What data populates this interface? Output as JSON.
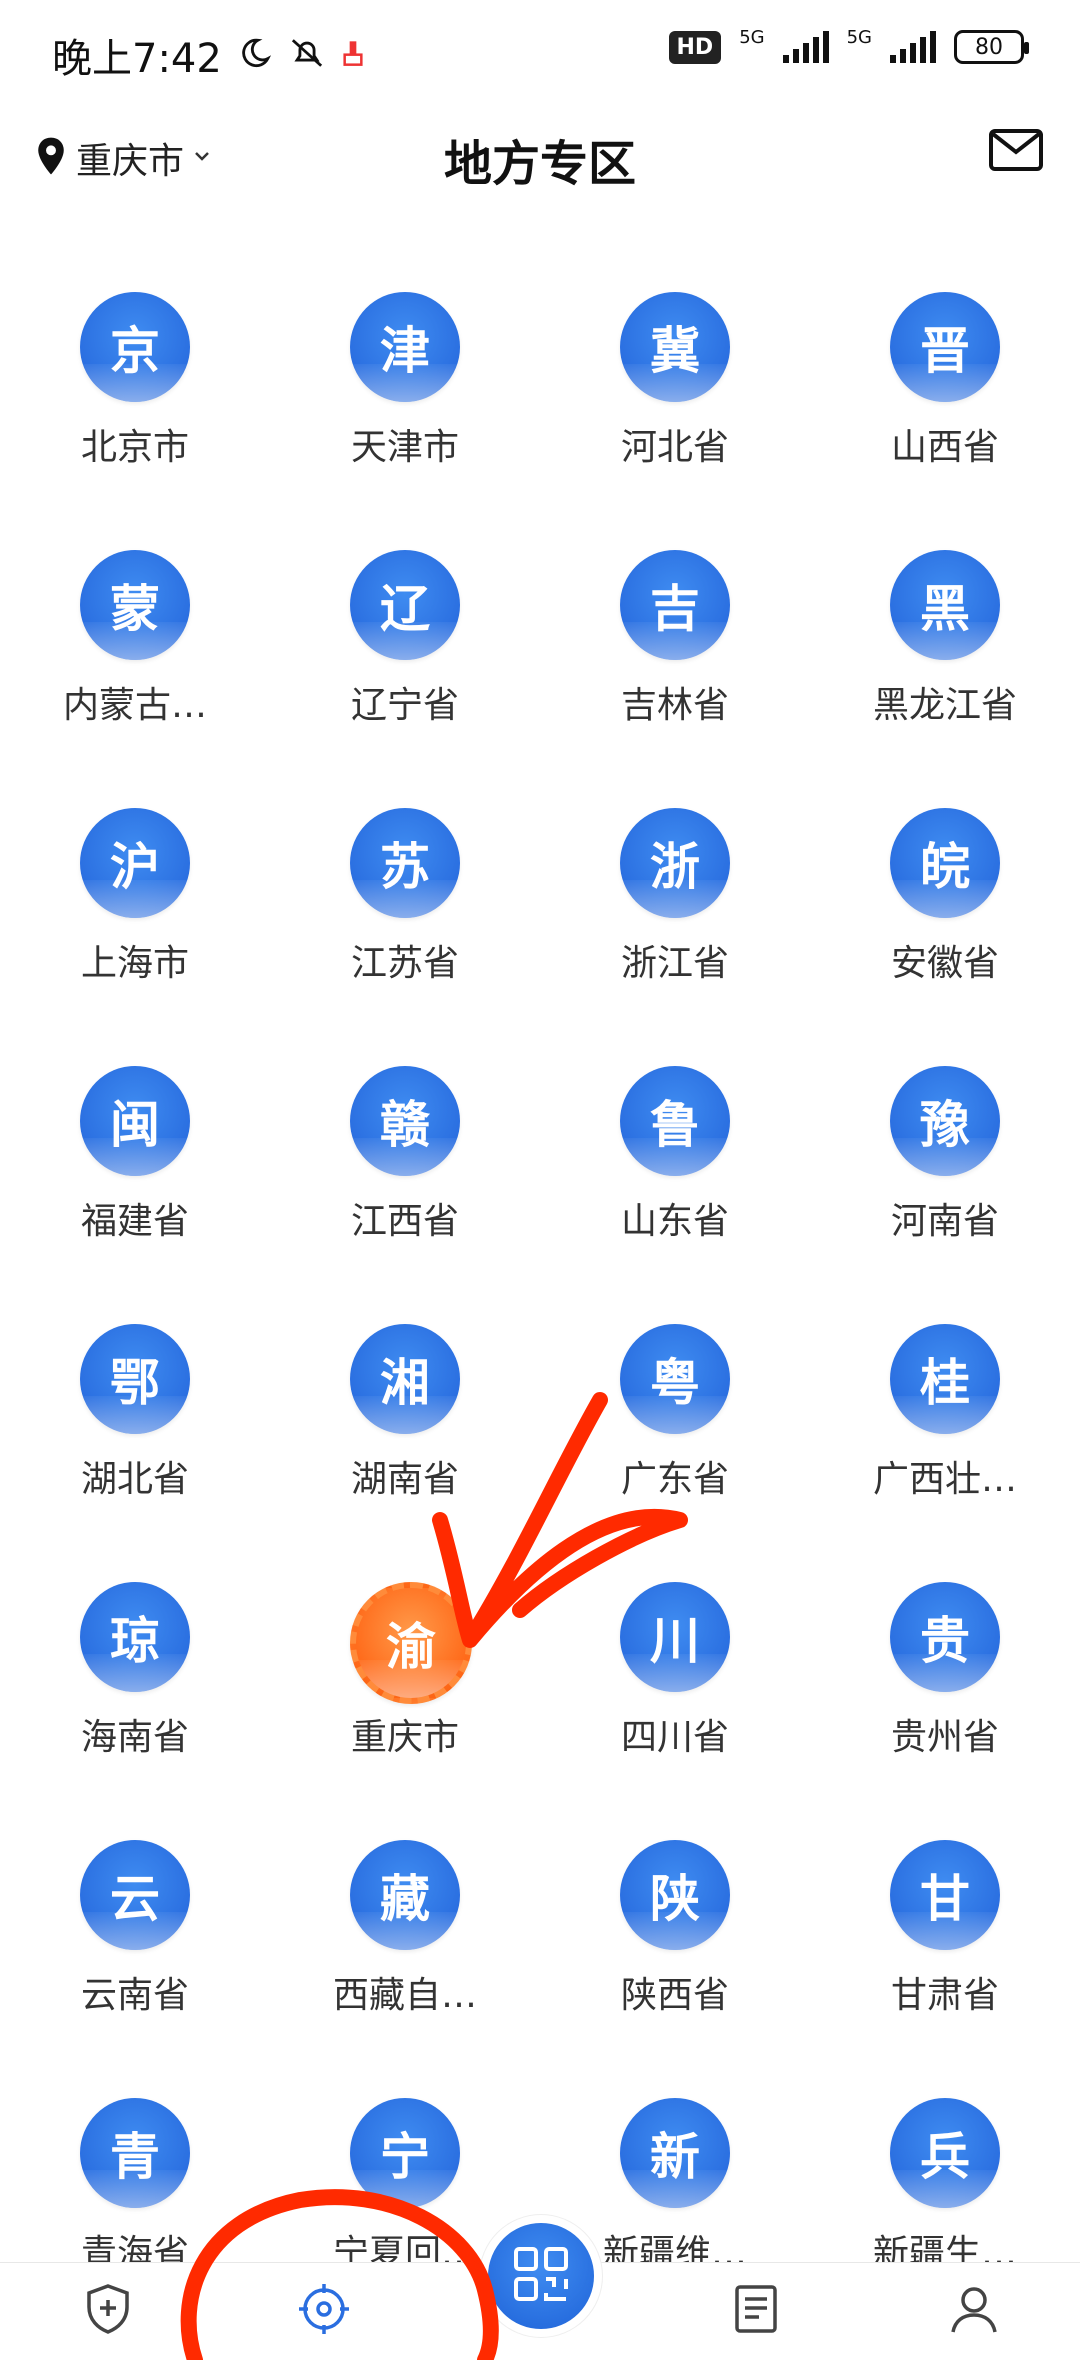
{
  "status_bar": {
    "time": "晚上7:42",
    "network_1": "5G",
    "network_2": "5G",
    "hd_label": "HD",
    "battery": "80"
  },
  "header": {
    "city": "重庆市",
    "title": "地方专区"
  },
  "regions": [
    {
      "char": "京",
      "label": "北京市"
    },
    {
      "char": "津",
      "label": "天津市"
    },
    {
      "char": "冀",
      "label": "河北省"
    },
    {
      "char": "晋",
      "label": "山西省"
    },
    {
      "char": "蒙",
      "label": "内蒙古…"
    },
    {
      "char": "辽",
      "label": "辽宁省"
    },
    {
      "char": "吉",
      "label": "吉林省"
    },
    {
      "char": "黑",
      "label": "黑龙江省"
    },
    {
      "char": "沪",
      "label": "上海市"
    },
    {
      "char": "苏",
      "label": "江苏省"
    },
    {
      "char": "浙",
      "label": "浙江省"
    },
    {
      "char": "皖",
      "label": "安徽省"
    },
    {
      "char": "闽",
      "label": "福建省"
    },
    {
      "char": "赣",
      "label": "江西省"
    },
    {
      "char": "鲁",
      "label": "山东省"
    },
    {
      "char": "豫",
      "label": "河南省"
    },
    {
      "char": "鄂",
      "label": "湖北省"
    },
    {
      "char": "湘",
      "label": "湖南省"
    },
    {
      "char": "粤",
      "label": "广东省"
    },
    {
      "char": "桂",
      "label": "广西壮…"
    },
    {
      "char": "琼",
      "label": "海南省"
    },
    {
      "char": "渝",
      "label": "重庆市",
      "active": true
    },
    {
      "char": "川",
      "label": "四川省"
    },
    {
      "char": "贵",
      "label": "贵州省"
    },
    {
      "char": "云",
      "label": "云南省"
    },
    {
      "char": "藏",
      "label": "西藏自…"
    },
    {
      "char": "陕",
      "label": "陕西省"
    },
    {
      "char": "甘",
      "label": "甘肃省"
    },
    {
      "char": "青",
      "label": "青海省"
    },
    {
      "char": "宁",
      "label": "宁夏回…"
    },
    {
      "char": "新",
      "label": "新疆维…"
    },
    {
      "char": "兵",
      "label": "新疆生…"
    }
  ],
  "colors": {
    "badge_blue": "#2a6ee0",
    "badge_active": "#ff6a1a",
    "annotation_red": "#ff2a00"
  },
  "bottom_nav": {
    "icons": [
      "shield-plus-icon",
      "target-icon",
      "qr-scan-icon",
      "document-icon",
      "person-icon"
    ]
  }
}
